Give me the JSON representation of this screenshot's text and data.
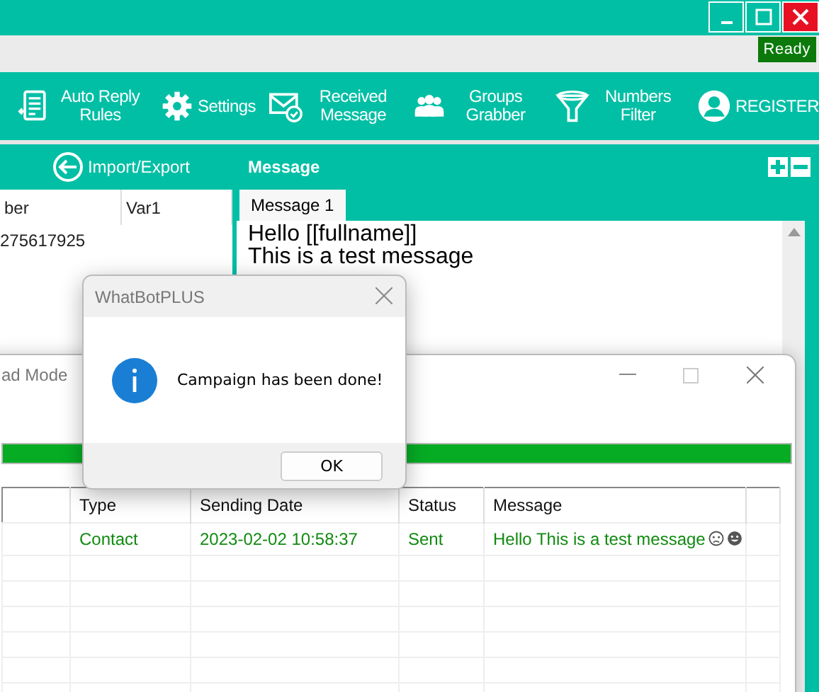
{
  "main_window": {
    "status": "Ready",
    "toolbar": [
      {
        "kind": "rules",
        "label": "Auto Reply Rules"
      },
      {
        "kind": "gear",
        "label": "Settings"
      },
      {
        "kind": "mail",
        "label": "Received Message"
      },
      {
        "kind": "group",
        "label": "Groups Grabber"
      },
      {
        "kind": "filter",
        "label": "Numbers Filter"
      },
      {
        "kind": "user",
        "label": "REGISTER"
      }
    ],
    "contacts": {
      "action": "Import/Export",
      "columns": [
        "ber",
        "Var1"
      ],
      "rows": [
        [
          "275617925",
          ""
        ]
      ]
    },
    "message": {
      "title": "Message",
      "tabs": [
        {
          "label": "Message 1",
          "selected": true
        }
      ],
      "lines": [
        "Hello [[fullname]]",
        "This is a test message"
      ]
    }
  },
  "send_window": {
    "title": "ad Mode",
    "progress": {
      "level": 1
    },
    "table": {
      "columns": [
        "",
        "Type",
        "Sending Date",
        "Status",
        "Message",
        ""
      ],
      "rows": [
        {
          "cells": [
            "",
            "Contact",
            "2023-02-02 10:58:37",
            "Sent",
            "Hello This is a test message"
          ]
        }
      ]
    }
  },
  "dialog": {
    "title": "WhatBotPLUS",
    "text": "Campaign has been done!",
    "button": "OK"
  }
}
